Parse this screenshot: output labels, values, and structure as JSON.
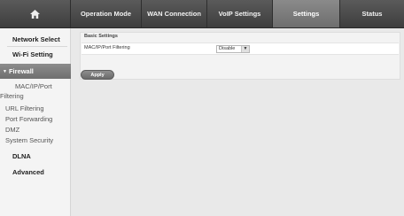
{
  "nav": {
    "home_icon": "home-icon",
    "tabs": [
      {
        "label": "Operation Mode"
      },
      {
        "label": "WAN Connection"
      },
      {
        "label": "VoIP Settings"
      },
      {
        "label": "Settings"
      },
      {
        "label": "Status"
      }
    ],
    "active_tab": "Settings"
  },
  "sidebar": {
    "network_select": "Network Select",
    "wifi_setting": "Wi-Fi Setting",
    "firewall": "Firewall",
    "firewall_items": {
      "mac_ip_port_line1": "MAC/IP/Port",
      "mac_ip_port_line2": "Filtering",
      "url_filtering": "URL Filtering",
      "port_forwarding": "Port Forwarding",
      "dmz": "DMZ",
      "system_security": "System Security"
    },
    "dlna": "DLNA",
    "advanced": "Advanced"
  },
  "main": {
    "section_title": "Basic Settings",
    "row_label": "MAC/IP/Port Filtering",
    "select_value": "Disable",
    "apply_label": "Apply"
  },
  "colors": {
    "topbar": "#4a4a4a",
    "active": "#7c7c7c",
    "background": "#e9e9e9"
  }
}
